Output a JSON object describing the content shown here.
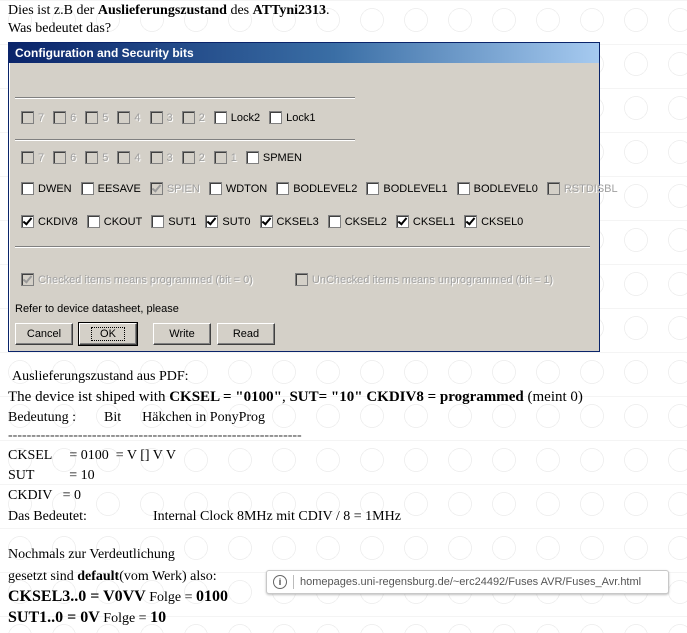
{
  "intro": {
    "line1_pre": "Dies ist z.B der ",
    "line1_bold1": "Auslieferungszustand",
    "line1_mid": " des ",
    "line1_bold2": "ATTyni2313",
    "line1_post": ".",
    "line2": "Was bedeutet das?"
  },
  "dialog": {
    "title": "Configuration and Security bits",
    "row1": [
      {
        "label": "7",
        "checked": false,
        "disabled": true
      },
      {
        "label": "6",
        "checked": false,
        "disabled": true
      },
      {
        "label": "5",
        "checked": false,
        "disabled": true
      },
      {
        "label": "4",
        "checked": false,
        "disabled": true
      },
      {
        "label": "3",
        "checked": false,
        "disabled": true
      },
      {
        "label": "2",
        "checked": false,
        "disabled": true
      },
      {
        "label": "Lock2",
        "checked": false,
        "disabled": false
      },
      {
        "label": "Lock1",
        "checked": false,
        "disabled": false
      }
    ],
    "row2": [
      {
        "label": "7",
        "checked": false,
        "disabled": true
      },
      {
        "label": "6",
        "checked": false,
        "disabled": true
      },
      {
        "label": "5",
        "checked": false,
        "disabled": true
      },
      {
        "label": "4",
        "checked": false,
        "disabled": true
      },
      {
        "label": "3",
        "checked": false,
        "disabled": true
      },
      {
        "label": "2",
        "checked": false,
        "disabled": true
      },
      {
        "label": "1",
        "checked": false,
        "disabled": true
      },
      {
        "label": "SPMEN",
        "checked": false,
        "disabled": false
      }
    ],
    "row3": [
      {
        "label": "DWEN",
        "checked": false,
        "disabled": false
      },
      {
        "label": "EESAVE",
        "checked": false,
        "disabled": false
      },
      {
        "label": "SPIEN",
        "checked": true,
        "disabled": true
      },
      {
        "label": "WDTON",
        "checked": false,
        "disabled": false
      },
      {
        "label": "BODLEVEL2",
        "checked": false,
        "disabled": false
      },
      {
        "label": "BODLEVEL1",
        "checked": false,
        "disabled": false
      },
      {
        "label": "BODLEVEL0",
        "checked": false,
        "disabled": false
      },
      {
        "label": "RSTDISBL",
        "checked": false,
        "disabled": true
      }
    ],
    "row4": [
      {
        "label": "CKDIV8",
        "checked": true,
        "disabled": false
      },
      {
        "label": "CKOUT",
        "checked": false,
        "disabled": false
      },
      {
        "label": "SUT1",
        "checked": false,
        "disabled": false
      },
      {
        "label": "SUT0",
        "checked": true,
        "disabled": false
      },
      {
        "label": "CKSEL3",
        "checked": true,
        "disabled": false
      },
      {
        "label": "CKSEL2",
        "checked": false,
        "disabled": false
      },
      {
        "label": "CKSEL1",
        "checked": true,
        "disabled": false
      },
      {
        "label": "CKSEL0",
        "checked": true,
        "disabled": false
      }
    ],
    "legend_checked": "Checked items means programmed (bit = 0)",
    "legend_unchecked": "UnChecked items means unprogrammed (bit = 1)",
    "refer": "Refer to device datasheet, please",
    "buttons": {
      "cancel": "Cancel",
      "ok": "OK",
      "write": "Write",
      "read": "Read"
    }
  },
  "body": {
    "pdf_heading": "Auslieferungszustand aus PDF:",
    "shipped_pre": "The device ist shiped with ",
    "shipped_b1": "CKSEL = \"0100\"",
    "shipped_mid1": ", ",
    "shipped_b2": "SUT= \"10\" CKDIV8 = programmed",
    "shipped_post": " (meint 0)",
    "meaning_line": "Bedeutung :        Bit      Häkchen in PonyProg",
    "divider": "---------------------------------------------------------------",
    "cksel_line": "CKSEL     = 0100  = V [] V V",
    "sut_line": "SUT          = 10",
    "ckdiv_line": "CKDIV   = 0",
    "bedeutet_label": "Das Bedeutet:",
    "bedeutet_value": "Internal Clock 8MHz mit CDIV / 8 = 1MHz",
    "nochmals": "Nochmals zur Verdeutlichung",
    "gesetzt_pre": "gesetzt sind ",
    "gesetzt_b": "default",
    "gesetzt_post": "(vom Werk) also:",
    "cksel_big_b": "CKSEL3..0 = V0VV",
    "cksel_big_mid": " Folge = ",
    "cksel_big_val": "0100",
    "sut_big_b": "SUT1..0 =  0V",
    "sut_big_mid": " Folge = ",
    "sut_big_val": "10"
  },
  "addressbar": {
    "url": "homepages.uni-regensburg.de/~erc24492/Fuses AVR/Fuses_Avr.html",
    "icon": "info-icon"
  }
}
